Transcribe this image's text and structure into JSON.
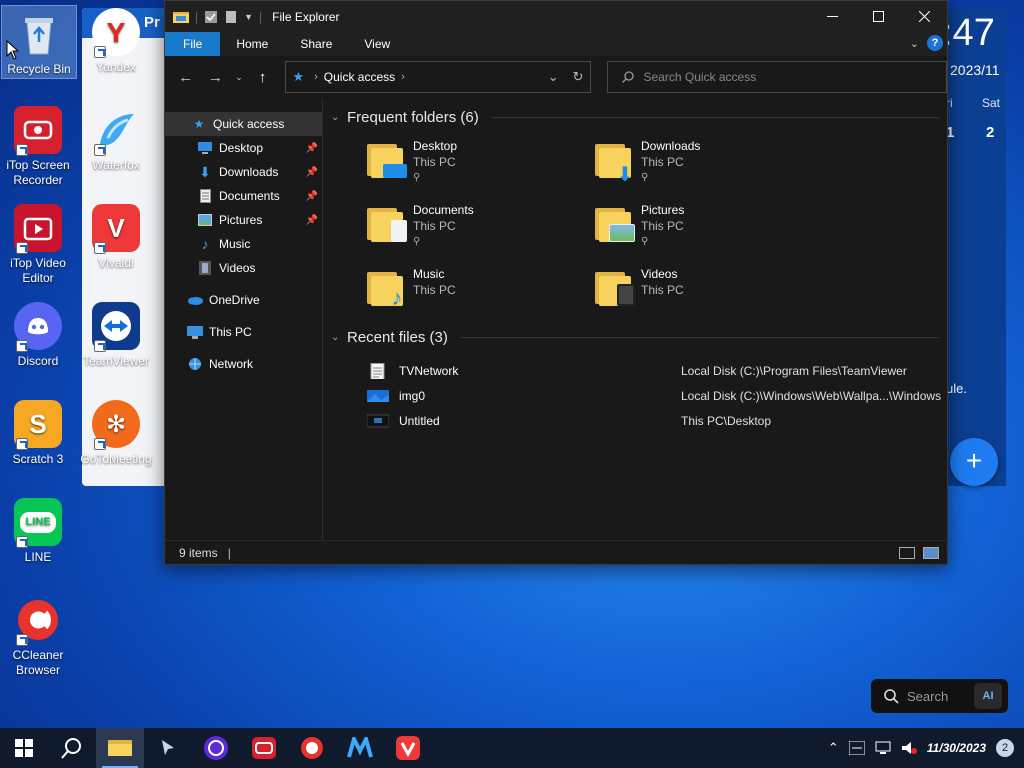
{
  "desktop": {
    "icons": [
      {
        "label": "Recycle Bin"
      },
      {
        "label": "Yandex"
      },
      {
        "label": "iTop Screen Recorder"
      },
      {
        "label": "Waterfox"
      },
      {
        "label": "iTop Video Editor"
      },
      {
        "label": "Vivaldi"
      },
      {
        "label": "Discord"
      },
      {
        "label": "TeamViewer"
      },
      {
        "label": "Scratch 3"
      },
      {
        "label": "GoToMeeting"
      },
      {
        "label": "LINE"
      },
      {
        "label": "CCleaner Browser"
      }
    ]
  },
  "background_app": {
    "title_fragment": "Pr",
    "clock_fragment": ":47",
    "date_fragment": "2023/11",
    "day_headers": [
      "ri",
      "Sat"
    ],
    "day_numbers": [
      "1",
      "2"
    ],
    "note_fragment": "ule.",
    "add_symbol": "+"
  },
  "explorer": {
    "title": "File Explorer",
    "ribbon_tabs": [
      "File",
      "Home",
      "Share",
      "View"
    ],
    "address": {
      "location": "Quick access"
    },
    "search": {
      "placeholder": "Search Quick access"
    },
    "nav": [
      {
        "label": "Quick access",
        "pinned": false
      },
      {
        "label": "Desktop",
        "pinned": true
      },
      {
        "label": "Downloads",
        "pinned": true
      },
      {
        "label": "Documents",
        "pinned": true
      },
      {
        "label": "Pictures",
        "pinned": true
      },
      {
        "label": "Music",
        "pinned": false
      },
      {
        "label": "Videos",
        "pinned": false
      },
      {
        "label": "OneDrive",
        "pinned": false
      },
      {
        "label": "This PC",
        "pinned": false
      },
      {
        "label": "Network",
        "pinned": false
      }
    ],
    "frequent": {
      "header": "Frequent folders (6)",
      "folders": [
        {
          "name": "Desktop",
          "location": "This PC",
          "pinned": true
        },
        {
          "name": "Downloads",
          "location": "This PC",
          "pinned": true
        },
        {
          "name": "Documents",
          "location": "This PC",
          "pinned": true
        },
        {
          "name": "Pictures",
          "location": "This PC",
          "pinned": true
        },
        {
          "name": "Music",
          "location": "This PC",
          "pinned": false
        },
        {
          "name": "Videos",
          "location": "This PC",
          "pinned": false
        }
      ]
    },
    "recent": {
      "header": "Recent files (3)",
      "files": [
        {
          "name": "TVNetwork",
          "path": "Local Disk (C:)\\Program Files\\TeamViewer"
        },
        {
          "name": "img0",
          "path": "Local Disk (C:)\\Windows\\Web\\Wallpa...\\Windows"
        },
        {
          "name": "Untitled",
          "path": "This PC\\Desktop"
        }
      ]
    },
    "status": {
      "items": "9 items"
    }
  },
  "desktop_search": {
    "placeholder": "Search",
    "ai_label": "AI"
  },
  "taskbar": {
    "date": "11/30/2023",
    "notifications": "2"
  },
  "colors": {
    "accent": "#1979ca",
    "explorer_bg": "#191919",
    "folder": "#f7d35d"
  }
}
